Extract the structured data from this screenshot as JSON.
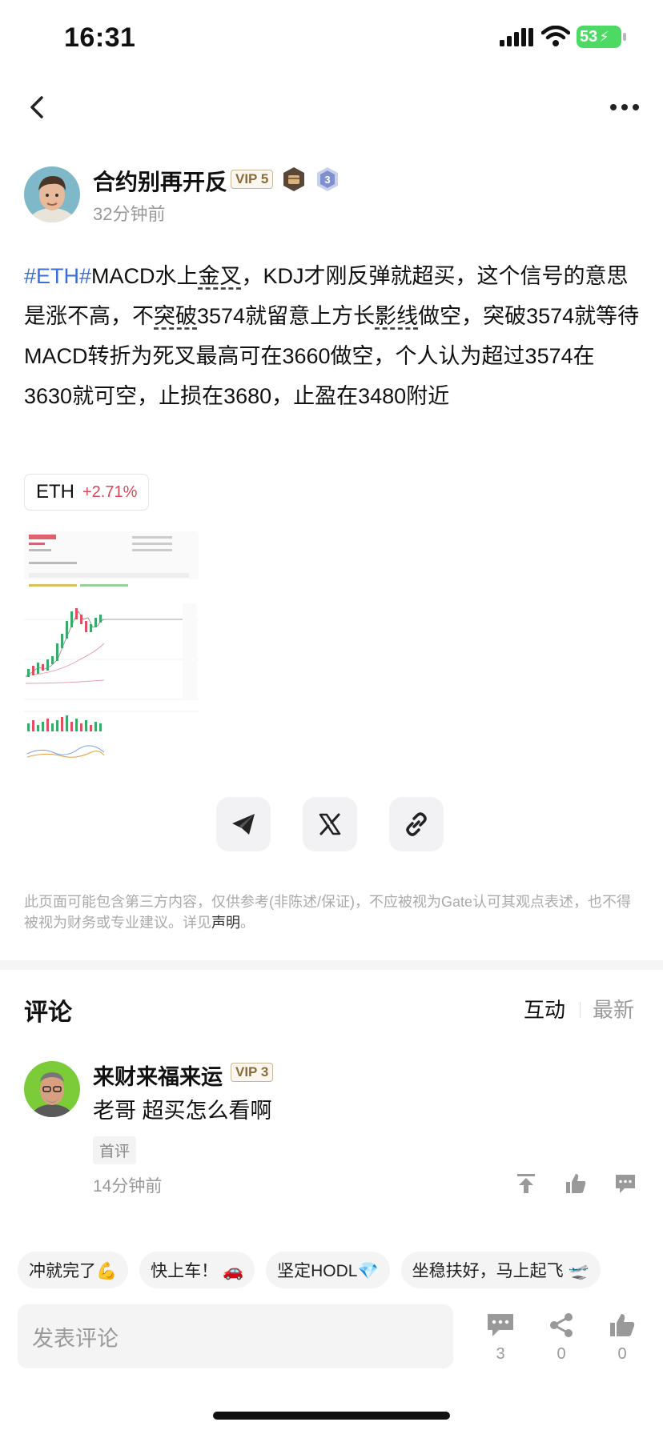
{
  "status_bar": {
    "time": "16:31",
    "battery": "53"
  },
  "author": {
    "name": "合约别再开反",
    "vip": "VIP 5",
    "level": "3",
    "posted": "32分钟前"
  },
  "post": {
    "tag": "#ETH#",
    "seg1": "MACD水上",
    "u1": "金叉",
    "seg2": "，KDJ才刚反弹就超买，这个信号的意思是涨不高，不",
    "u2": "突破",
    "seg3": "3574就留意上方长",
    "u3": "影线",
    "seg4": "做空，突破3574就等待MACD转折为死叉最高可在3660做空，个人认为超过3574在3630就可空，止损在3680，止盈在3480附近"
  },
  "coin": {
    "symbol": "ETH",
    "change": "+2.71%"
  },
  "disclaimer": {
    "text": "此页面可能包含第三方内容，仅供参考(非陈述/保证)，不应被视为Gate认可其观点表述，也不得被视为财务或专业建议。详见",
    "link": "声明",
    "end": "。"
  },
  "comments": {
    "title": "评论",
    "tab_interact": "互动",
    "tab_latest": "最新",
    "item": {
      "name": "来财来福来运",
      "vip": "VIP 3",
      "text": "老哥 超买怎么看啊",
      "badge": "首评",
      "time": "14分钟前"
    }
  },
  "quick_replies": [
    "冲就完了💪",
    "快上车！ 🚗",
    "坚定HODL💎",
    "坐稳扶好，马上起飞 🛫"
  ],
  "input": {
    "placeholder": "发表评论"
  },
  "stats": {
    "comments": "3",
    "shares": "0",
    "likes": "0"
  },
  "colors": {
    "tag_blue": "#3a6fd8",
    "change_red": "#d9475a",
    "battery_green": "#4cd964"
  }
}
